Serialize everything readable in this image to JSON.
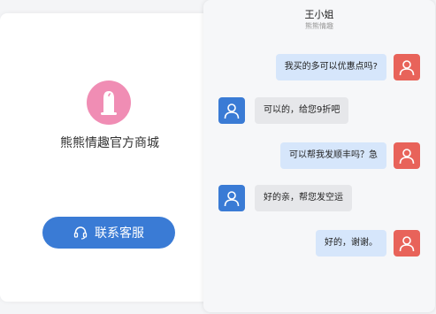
{
  "store": {
    "name": "熊熊情趣官方商城",
    "logo_icon": "condom-icon",
    "contact_button_label": "联系客服",
    "brand_color": "#f08db4",
    "button_color": "#3a7bd5"
  },
  "chat": {
    "title": "王小姐",
    "subtitle": "熊熊情趣",
    "messages": [
      {
        "side": "right",
        "sender": "user",
        "text": "我买的多可以优惠点吗?"
      },
      {
        "side": "left",
        "sender": "agent",
        "text": "可以的，给您9折吧"
      },
      {
        "side": "right",
        "sender": "user",
        "text": "可以帮我发顺丰吗？急"
      },
      {
        "side": "left",
        "sender": "agent",
        "text": "好的亲，帮您发空运"
      },
      {
        "side": "right",
        "sender": "user",
        "text": "好的，谢谢。"
      }
    ],
    "colors": {
      "user_avatar": "#e8635a",
      "agent_avatar": "#3a7bd5",
      "user_bubble": "#d6e6fb",
      "agent_bubble": "#e6e7ea"
    }
  }
}
